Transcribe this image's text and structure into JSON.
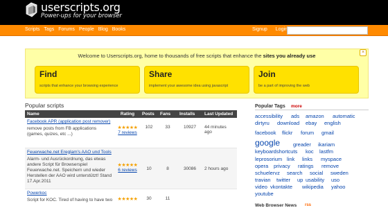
{
  "header": {
    "site_title": "userscripts.org",
    "tagline": "Power-ups for your browser",
    "nav": [
      "Scripts",
      "Tags",
      "Forums",
      "People",
      "Blog",
      "Books"
    ],
    "user_links": [
      "Signup",
      "Login"
    ],
    "search_value": ""
  },
  "banner": {
    "text_before": "Welcome to Userscripts.org, home to thousands of free scripts that enhance the ",
    "text_bold": "sites you already use",
    "close_symbol": "×",
    "features": [
      {
        "title": "Find",
        "desc": "scripts that enhance your browsing experience"
      },
      {
        "title": "Share",
        "desc": "implement your awesome idea using javascript"
      },
      {
        "title": "Join",
        "desc": "be a part of improving the web"
      }
    ]
  },
  "popular": {
    "title": "Popular scripts",
    "columns": [
      "Name",
      "Rating",
      "Posts",
      "Fans",
      "Installs",
      "Last Updated"
    ],
    "rows": [
      {
        "name": "Facebook APR (application post remover)",
        "desc": "remove posts from FB applications (games, quizes, etc ...)",
        "stars": "★★★★★",
        "reviews": "7 reviews",
        "posts": "102",
        "fans": "33",
        "installs": "10927",
        "updated": "44 minutes ago"
      },
      {
        "name": "Feuerwache.net Ereglam's AAO und Tools",
        "desc": "Alarm- und Ausrückordnung, das etwas andere Script für Browserspiel Feuerwache.net. Speichern und wieder Herstellen der AAO wird unterstützt! Stand 17.Apr.2011",
        "stars": "★★★★★",
        "reviews": "6 reviews",
        "posts": "10",
        "fans": "8",
        "installs": "30086",
        "updated": "2 hours ago"
      },
      {
        "name": "Powerkoc",
        "desc": "Script for KOC. Tired of having to have two",
        "stars": "★★★★★",
        "reviews": "",
        "posts": "30",
        "fans": "11",
        "installs": "",
        "updated": ""
      }
    ]
  },
  "tags": {
    "title": "Popular Tags",
    "more": "more",
    "items": [
      "accessibility",
      "ads",
      "amazon",
      "automatic",
      "dirtyru",
      "download",
      "ebay",
      "english",
      "facebook",
      "flickr",
      "forum",
      "gmail",
      "google",
      "greader",
      "ikariam",
      "keyboardshortcuts",
      "koc",
      "lastfm",
      "leprosorium",
      "link",
      "links",
      "myspace",
      "opera",
      "privacy",
      "ratings",
      "remove",
      "schuelervz",
      "search",
      "social",
      "sweden",
      "travian",
      "twitter",
      "up",
      "usability",
      "uso",
      "video",
      "vkontakte",
      "wikipedia",
      "yahoo",
      "youtube"
    ]
  },
  "news": {
    "title": "Web Browser News",
    "rss": "rss"
  },
  "colors": {
    "topbar": "#000000",
    "navbar": "#ff8a00",
    "banner": "#ffffa6",
    "feature": "#ffe100",
    "link": "#0645ad"
  }
}
